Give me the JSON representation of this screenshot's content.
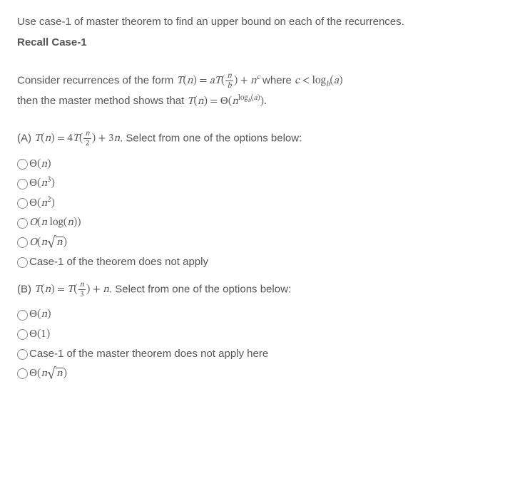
{
  "intro": "Use case-1 of master theorem to find an upper bound on each of the recurrences.",
  "recall": "Recall Case-1",
  "consider_prefix": "Consider recurrences of the form ",
  "where_text": " where ",
  "then_prefix": "then the master method shows that ",
  "qA": {
    "label": "(A) ",
    "tail": ". Select from one of the options below:",
    "options_text": {
      "o5": "Case-1 of the theorem does not apply"
    }
  },
  "qB": {
    "label": "(B) ",
    "tail": ". Select from one of the options below:",
    "options_text": {
      "o2": "Case-1 of the master theorem does not apply here"
    }
  },
  "chart_data": {
    "type": "table",
    "note": "Math expressions as displayed in the document (not a chart; quiz content).",
    "recurrence_form": "T(n) = a T(n/b) + n^c  where  c < log_b(a)",
    "conclusion": "T(n) = Θ(n^{log_b(a)})",
    "partA": {
      "recurrence": "T(n) = 4 T(n/2) + 3n",
      "options": [
        "Θ(n)",
        "Θ(n^3)",
        "Θ(n^2)",
        "O(n log(n))",
        "O(n√n)",
        "Case-1 of the theorem does not apply"
      ]
    },
    "partB": {
      "recurrence": "T(n) = T(n/3) + n",
      "options": [
        "Θ(n)",
        "Θ(1)",
        "Case-1 of the master theorem does not apply here",
        "Θ(n√n)"
      ]
    }
  }
}
